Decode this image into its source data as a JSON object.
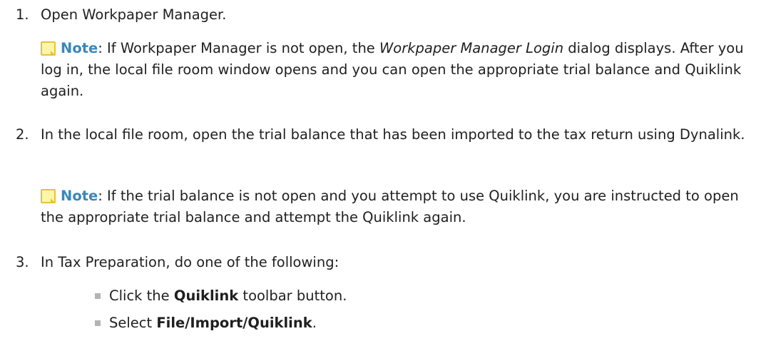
{
  "steps": [
    {
      "number": "1.",
      "text": "Open Workpaper Manager.",
      "note": {
        "label": "Note",
        "colon": ":",
        "pre": " If Workpaper Manager is not open, the ",
        "italic": "Workpaper Manager Login",
        "post": " dialog displays. After you log in, the local file room window opens and you can open the appropriate trial balance and Quiklink again."
      }
    },
    {
      "number": "2.",
      "text": "In the local file room, open the trial balance that has been imported to the tax return using Dynalink.",
      "note": {
        "label": "Note",
        "colon": ":",
        "text": " If the trial balance is not open and you attempt to use Quiklink, you are instructed to open the appropriate trial balance and attempt the Quiklink again."
      }
    },
    {
      "number": "3.",
      "text": "In Tax Preparation, do one of the following:",
      "bullets": [
        {
          "pre": "Click the ",
          "bold": "Quiklink",
          "post": " toolbar button."
        },
        {
          "pre": "Select ",
          "bold": "File/Import/Quiklink",
          "post": "."
        }
      ]
    }
  ],
  "colors": {
    "note_label": "#3a87b7",
    "note_icon_fill": "#fdf6a6",
    "note_icon_border": "#e6c23a",
    "bullet": "#b4b4b4",
    "text": "#1f1f1f"
  },
  "icons": {
    "note": "sticky-note-icon",
    "bullet": "square-bullet-icon"
  }
}
